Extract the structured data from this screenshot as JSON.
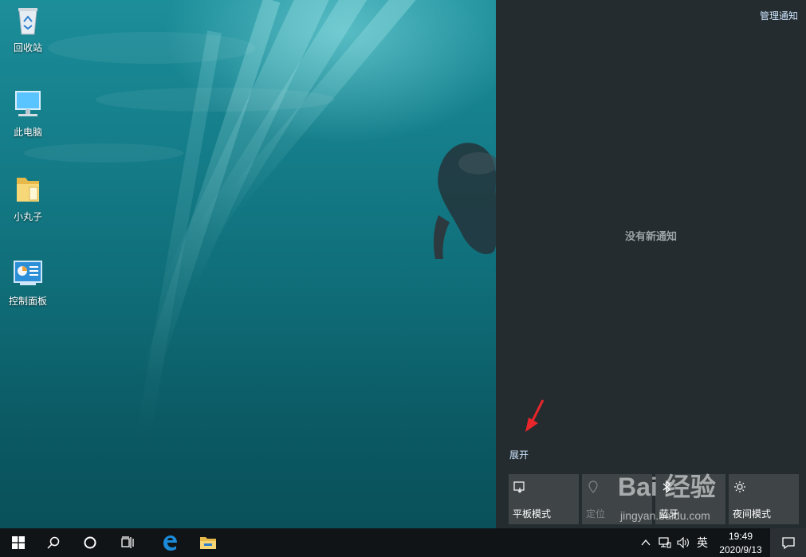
{
  "desktop": {
    "icons": [
      {
        "label": "回收站"
      },
      {
        "label": "此电脑"
      },
      {
        "label": "小丸子"
      },
      {
        "label": "控制面板"
      }
    ]
  },
  "action_center": {
    "manage_label": "管理通知",
    "empty_label": "没有新通知",
    "expand_label": "展开",
    "tiles": [
      {
        "label": "平板模式",
        "icon": "tablet-mode-icon",
        "state": "on"
      },
      {
        "label": "定位",
        "icon": "location-icon",
        "state": "off"
      },
      {
        "label": "蓝牙",
        "icon": "bluetooth-icon",
        "state": "on"
      },
      {
        "label": "夜间模式",
        "icon": "night-light-icon",
        "state": "on"
      }
    ]
  },
  "taskbar": {
    "ime_label": "英",
    "time": "19:49",
    "date": "2020/9/13"
  },
  "watermark": {
    "text": "Bai 经验",
    "url": "jingyan.baidu.com"
  },
  "colors": {
    "action_center_bg": "#252c2f",
    "tile_bg": "#3f4547",
    "link": "#cfe6ff",
    "arrow": "#e8262b"
  }
}
